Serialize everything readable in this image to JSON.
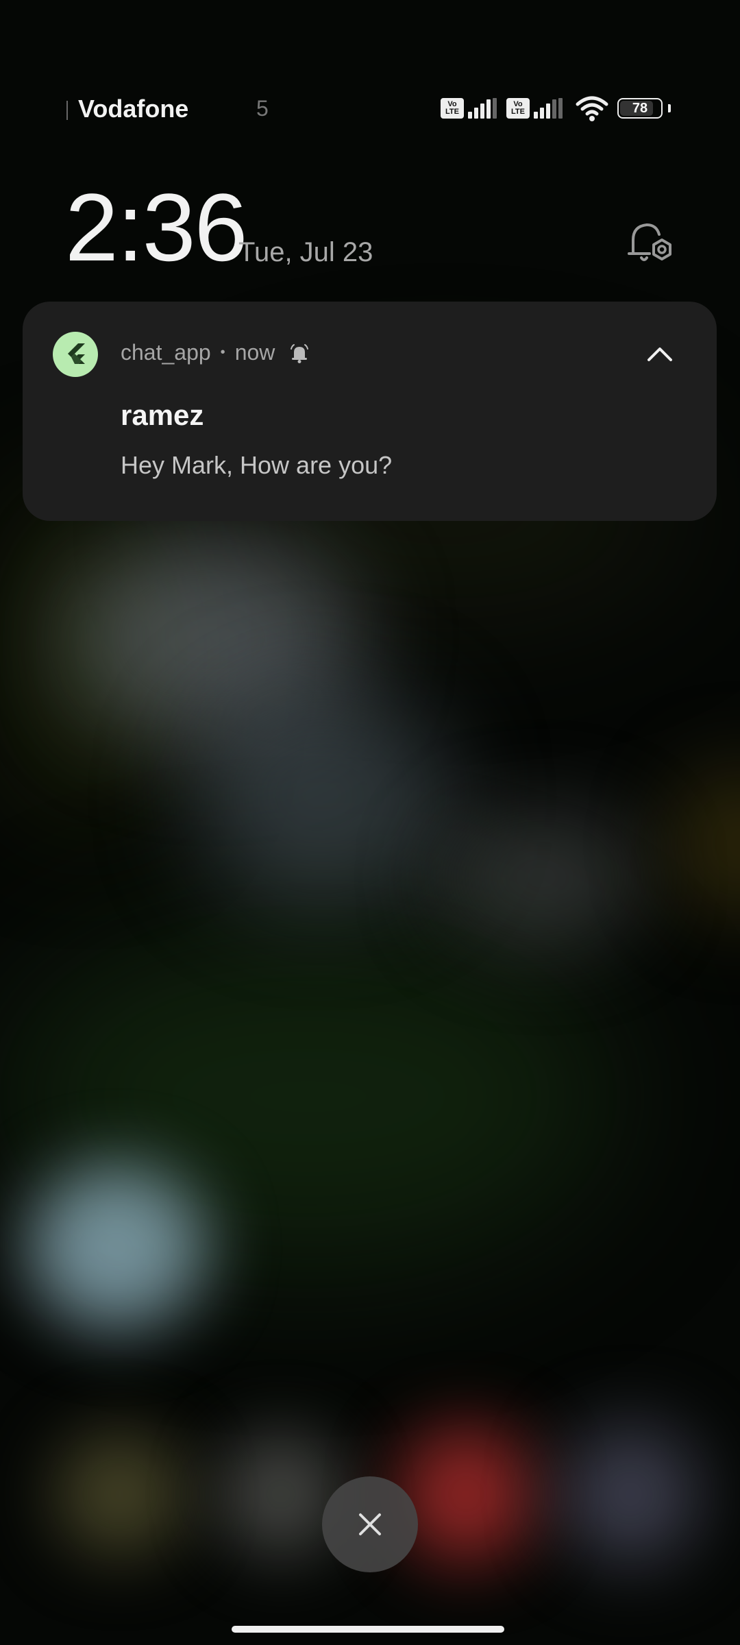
{
  "status_bar": {
    "carrier": "Vodafone",
    "network_type": "5",
    "sim1_label_top": "Vo",
    "sim1_label_bottom": "LTE",
    "sim2_label_top": "Vo",
    "sim2_label_bottom": "LTE",
    "battery_level": "78",
    "icons": [
      "volte-icon",
      "signal-icon",
      "volte-icon",
      "signal-icon",
      "wifi-icon",
      "battery-icon"
    ]
  },
  "lockscreen": {
    "time": "2:36",
    "date": "Tue, Jul 23",
    "settings_icon": "notification-settings-icon"
  },
  "notification": {
    "app_icon": "flutter-icon",
    "app_name": "chat_app",
    "separator": "•",
    "time": "now",
    "title": "ramez",
    "message": "Hey Mark, How are you?",
    "accent_color": "#b8ebb0"
  },
  "controls": {
    "dismiss_icon": "close-icon"
  }
}
